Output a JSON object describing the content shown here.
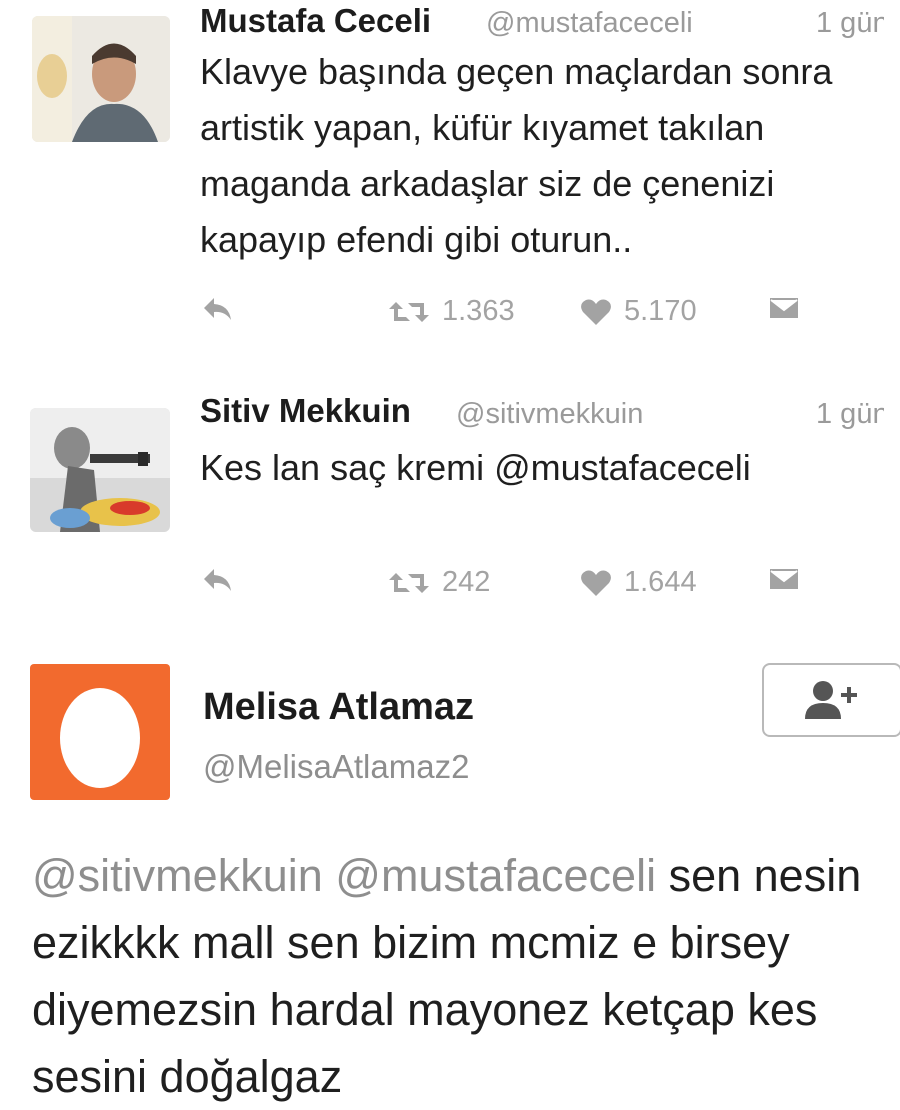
{
  "tweets": [
    {
      "name": "Mustafa Ceceli",
      "handle": "@mustafaceceli",
      "time": "1 gün",
      "text": "Klavye başında geçen maçlardan sonra artistik yapan, küfür kıyamet takılan maganda arkadaşlar siz de çenenizi kapayıp efendi gibi oturun..",
      "retweets": "1.363",
      "likes": "5.170"
    },
    {
      "name": "Sitiv Mekkuin",
      "handle": "@sitivmekkuin",
      "time": "1 gün",
      "text": "Kes lan saç kremi @mustafaceceli",
      "retweets": "242",
      "likes": "1.644"
    }
  ],
  "reply": {
    "name": "Melisa Atlamaz",
    "handle": "@MelisaAtlamaz2",
    "mention1": "@sitivmekkuin",
    "mention2": "@mustafaceceli",
    "text": "sen nesin ezikkkk mall sen bizim mcmiz e birsey diyemezsin hardal mayonez ketçap kes sesini doğalgaz",
    "avatar_color": "#f26a2e"
  },
  "icons": {
    "reply": "reply-icon",
    "retweet": "retweet-icon",
    "like": "heart-icon",
    "message": "envelope-icon",
    "follow": "add-user-icon"
  },
  "colors": {
    "muted": "#a3a3a3",
    "text": "#1c1c1c"
  }
}
